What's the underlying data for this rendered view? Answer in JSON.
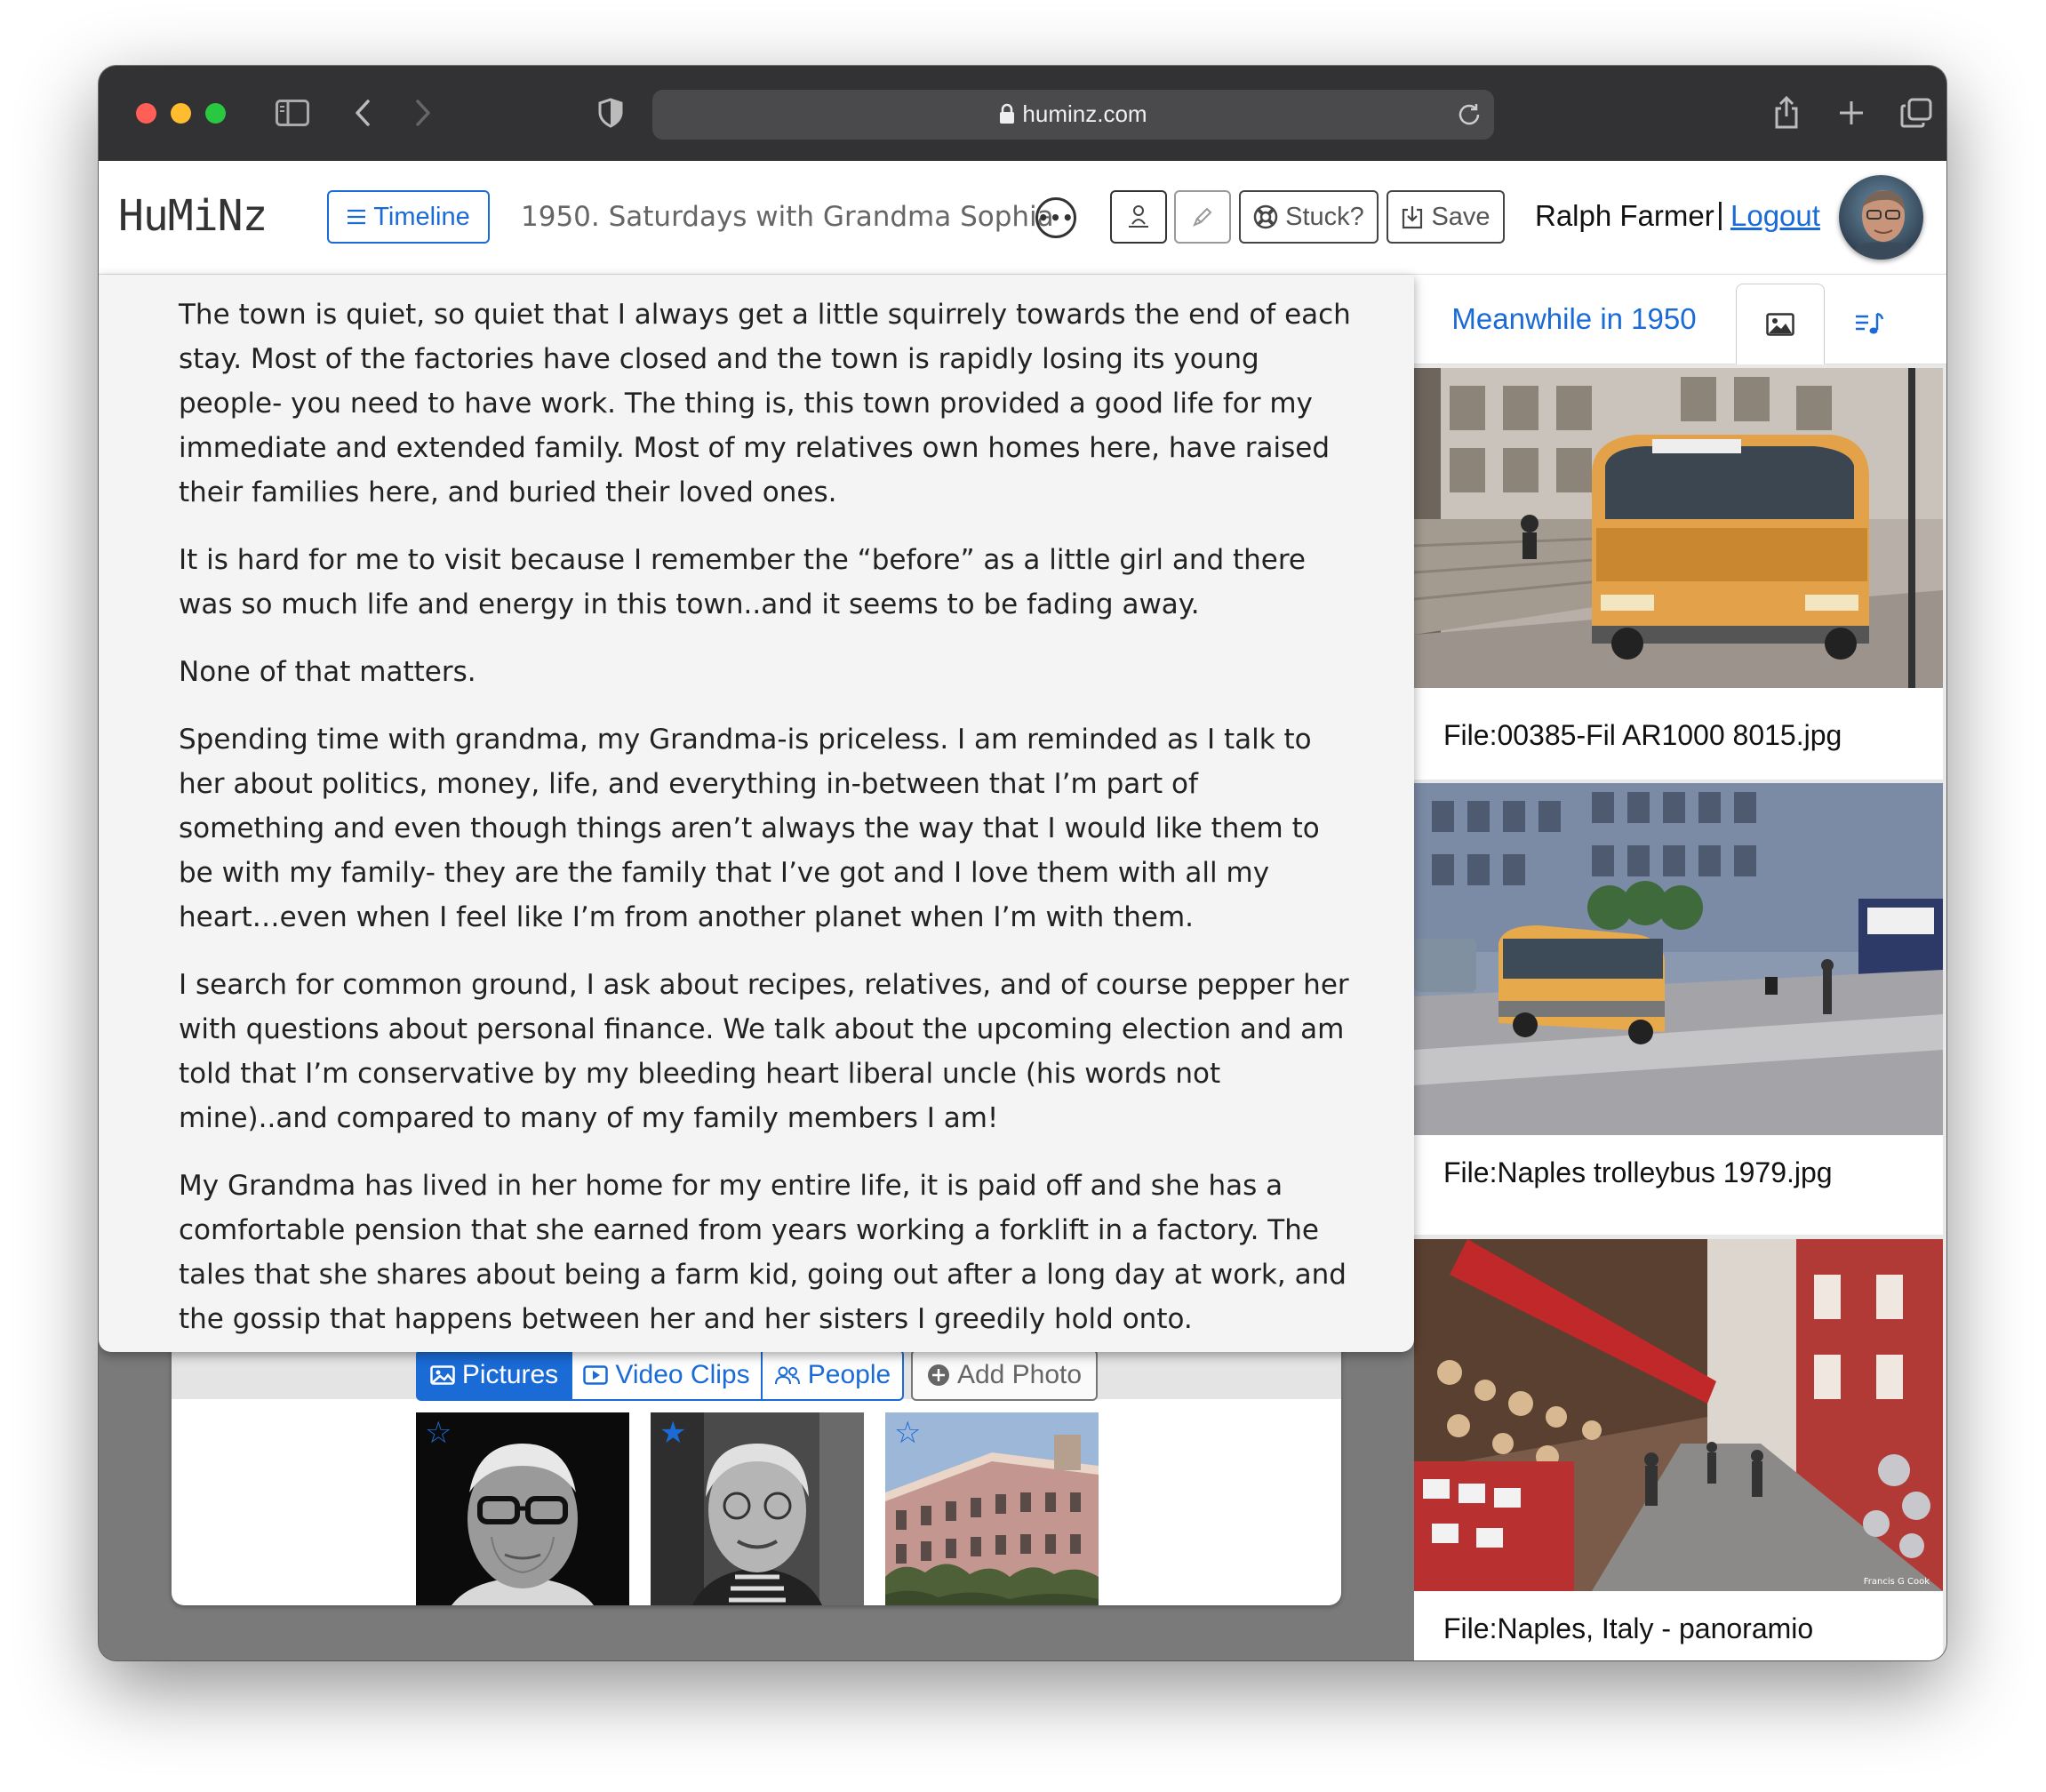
{
  "browser": {
    "url": "huminz.com"
  },
  "header": {
    "logo": "HuMiNz",
    "timeline_label": "Timeline",
    "doc_title": "1950. Saturdays with Grandma Sophia",
    "more_label": "•••",
    "stuck_label": "Stuck?",
    "save_label": "Save",
    "user_name": "Ralph Farmer",
    "separator": "|",
    "logout_label": "Logout"
  },
  "story": {
    "paragraphs": [
      "The town is quiet, so quiet that I always get a little squirrely towards the end of each stay. Most of the factories have closed and the town is rapidly losing its young people- you need to have work. The thing is, this town provided a good life for my immediate and extended family. Most of my relatives own homes here, have raised their families here, and buried their loved ones.",
      "It is hard for me to visit because I remember the “before” as a little girl and there was so much life and energy in this town..and it seems to be fading away.",
      "None of that matters.",
      "Spending time with grandma, my Grandma-is priceless. I am reminded as I talk to her about politics, money, life, and everything in-between that I’m part of something and even though things aren’t always the way that I would like them to be with my family- they are the family that I’ve got and I love them with all my heart…even when I feel like I’m from another planet when I’m with them.",
      "I search for common ground, I ask about recipes, relatives, and of course pepper her with questions about personal finance. We talk about the upcoming election and am told that I’m conservative by my bleeding heart liberal uncle (his words not mine)..and compared to many of my family members I am!",
      "My Grandma has lived in her home for my entire life, it is paid off and she has a comfortable pension that she earned from years working a forklift in a factory. The tales that she shares about being a farm kid, going out after a long day at work, and the gossip that happens between her and her sisters I greedily hold onto."
    ]
  },
  "media": {
    "tabs": [
      {
        "label": "Pictures",
        "active": true
      },
      {
        "label": "Video Clips",
        "active": false
      },
      {
        "label": "People",
        "active": false
      }
    ],
    "add_photo_label": "Add Photo",
    "thumbnails": [
      {
        "starred": false
      },
      {
        "starred": true
      },
      {
        "starred": false
      }
    ]
  },
  "sidebar": {
    "tab_label": "Meanwhile in 1950",
    "items": [
      {
        "caption": "File:00385-Fil AR1000 8015.jpg"
      },
      {
        "caption": "File:Naples trolleybus 1979.jpg"
      },
      {
        "caption": "File:Naples, Italy - panoramio"
      }
    ],
    "photo_credit": "Francis G Cook"
  },
  "colors": {
    "accent": "#1a6bd6",
    "chrome": "#323234",
    "page_bg": "#7a7a7a"
  }
}
